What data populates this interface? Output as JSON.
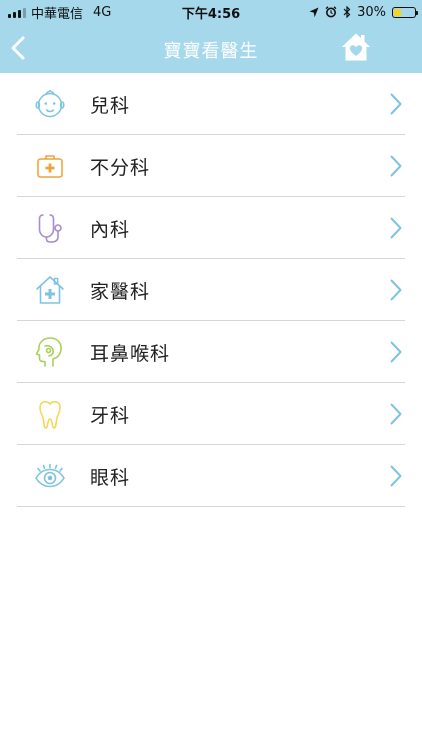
{
  "status_bar": {
    "carrier": "中華電信",
    "network": "4G",
    "time": "下午4:56",
    "battery_percent": "30%",
    "battery_level": 0.3,
    "battery_color": "#f5d322"
  },
  "nav": {
    "title": "寶寶看醫生",
    "back_icon": "chevron-left-icon",
    "home_icon": "home-heart-icon",
    "bar_color": "#a6d8eb"
  },
  "departments": [
    {
      "label": "兒科",
      "icon": "baby-face-icon",
      "color": "#7ec4e0"
    },
    {
      "label": "不分科",
      "icon": "medical-kit-icon",
      "color": "#f0a33a"
    },
    {
      "label": "內科",
      "icon": "stethoscope-icon",
      "color": "#a78ccf"
    },
    {
      "label": "家醫科",
      "icon": "house-cross-icon",
      "color": "#7ec4e0"
    },
    {
      "label": "耳鼻喉科",
      "icon": "head-profile-icon",
      "color": "#a8d05a"
    },
    {
      "label": "牙科",
      "icon": "tooth-icon",
      "color": "#f2d85a"
    },
    {
      "label": "眼科",
      "icon": "eye-icon",
      "color": "#7ec4e0"
    }
  ],
  "chevron_color": "#7ec4e0"
}
